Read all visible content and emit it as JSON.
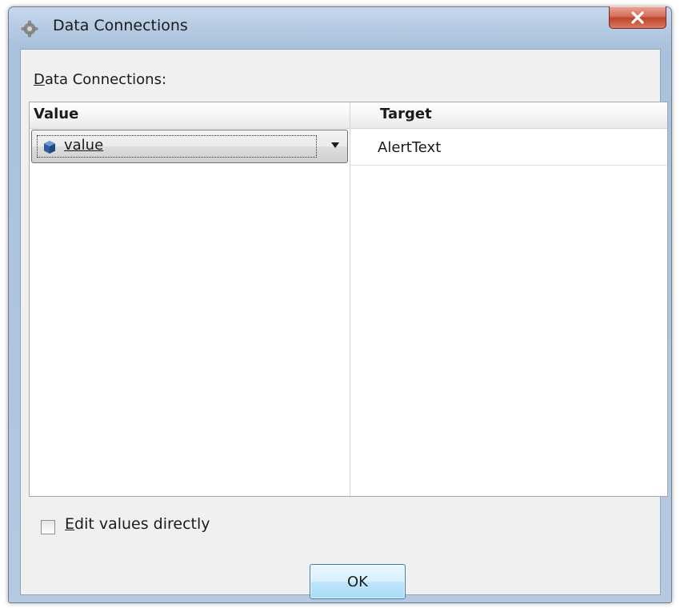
{
  "window": {
    "title": "Data Connections",
    "close_label": "x"
  },
  "dialog": {
    "label_mnemonic": "D",
    "label_rest": "ata Connections:"
  },
  "grid": {
    "columns": [
      "Value",
      "Target"
    ],
    "rows": [
      {
        "value": "value",
        "target": "AlertText"
      }
    ]
  },
  "options": {
    "checkbox_mnemonic": "E",
    "checkbox_rest": "dit values directly",
    "checked": false
  },
  "buttons": {
    "ok": "OK"
  },
  "colors": {
    "title_bar": "#b9cde4",
    "close_button": "#c0452c",
    "client_bg": "#f0f0f0",
    "value_icon": "#2f5f9e"
  }
}
